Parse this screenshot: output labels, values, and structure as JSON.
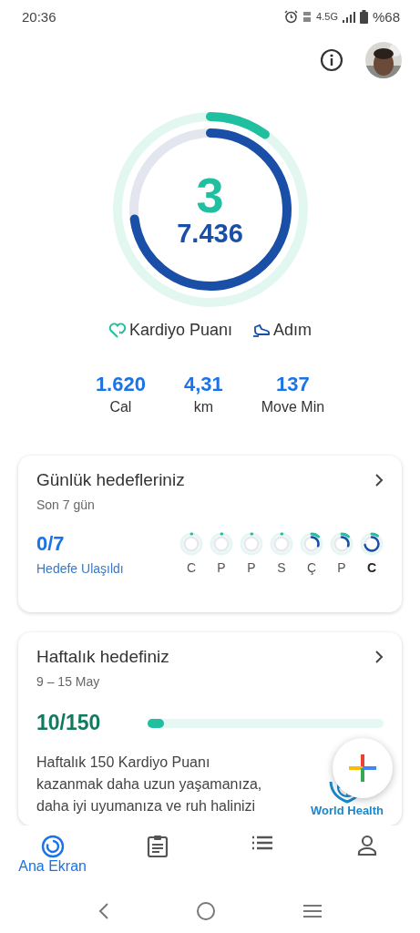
{
  "status_bar": {
    "time": "20:36",
    "network": "4.5G",
    "battery": "%68"
  },
  "summary": {
    "cardio_points": "3",
    "steps": "7.436",
    "legend": [
      {
        "kind": "heart",
        "label": "Kardiyo Puanı"
      },
      {
        "kind": "shoe",
        "label": "Adım"
      }
    ],
    "stats": [
      {
        "value": "1.620",
        "label": "Cal"
      },
      {
        "value": "4,31",
        "label": "km"
      },
      {
        "value": "137",
        "label": "Move Min"
      }
    ]
  },
  "daily_goals": {
    "title": "Günlük hedefleriniz",
    "subtitle": "Son 7 gün",
    "count": "0/7",
    "count_label": "Hedefe Ulaşıldı",
    "days": [
      {
        "label": "C",
        "kind": "empty",
        "selected": false
      },
      {
        "label": "P",
        "kind": "empty",
        "selected": false
      },
      {
        "label": "P",
        "kind": "empty",
        "selected": false
      },
      {
        "label": "S",
        "kind": "empty",
        "selected": false
      },
      {
        "label": "Ç",
        "kind": "partial",
        "selected": false
      },
      {
        "label": "P",
        "kind": "partial",
        "selected": false
      },
      {
        "label": "C",
        "kind": "most",
        "selected": true
      }
    ]
  },
  "weekly_goal": {
    "title": "Haftalık hedefiniz",
    "date_range": "9 – 15 May",
    "count": "10/150",
    "level": 0.067,
    "text": "Haftalık 150 Kardiyo Puanı kazanmak daha uzun yaşamanıza, daha iyi uyumanıza ve ruh halinizi",
    "source": "World Health"
  },
  "bottom_nav": [
    {
      "kind": "home",
      "label": "Ana Ekran",
      "selected": true
    },
    {
      "kind": "journal",
      "selected": false
    },
    {
      "kind": "browse",
      "selected": false
    },
    {
      "kind": "profile",
      "selected": false
    }
  ]
}
